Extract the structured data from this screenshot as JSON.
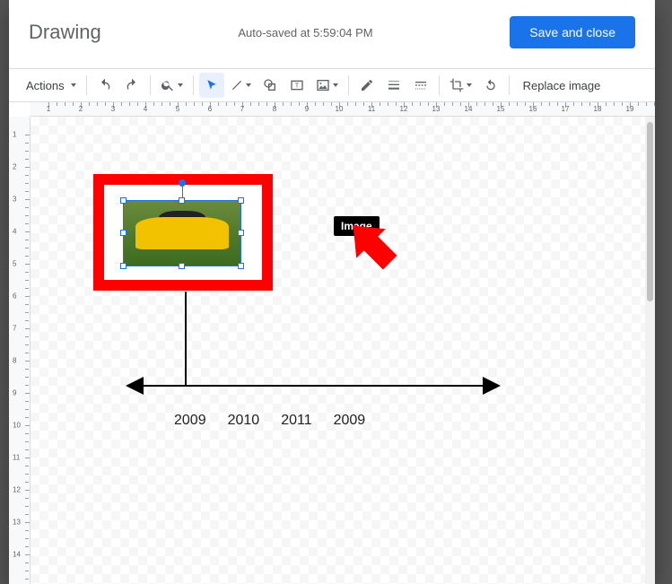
{
  "dialog": {
    "title": "Drawing",
    "status": "Auto-saved at 5:59:04 PM",
    "save_label": "Save and close"
  },
  "toolbar": {
    "actions_label": "Actions",
    "replace_image_label": "Replace image"
  },
  "tooltip": {
    "image_label": "Image"
  },
  "timeline": {
    "years": [
      "2009",
      "2010",
      "2011",
      "2009"
    ]
  },
  "ruler": {
    "h_labels": [
      "1",
      "2",
      "3",
      "4",
      "5",
      "6",
      "7",
      "8",
      "9",
      "10",
      "11",
      "12",
      "13",
      "14",
      "15",
      "16",
      "17",
      "18",
      "19"
    ],
    "v_labels": [
      "1",
      "2",
      "3",
      "4",
      "5",
      "6",
      "7",
      "8",
      "9",
      "10",
      "11",
      "12",
      "13",
      "14"
    ]
  }
}
